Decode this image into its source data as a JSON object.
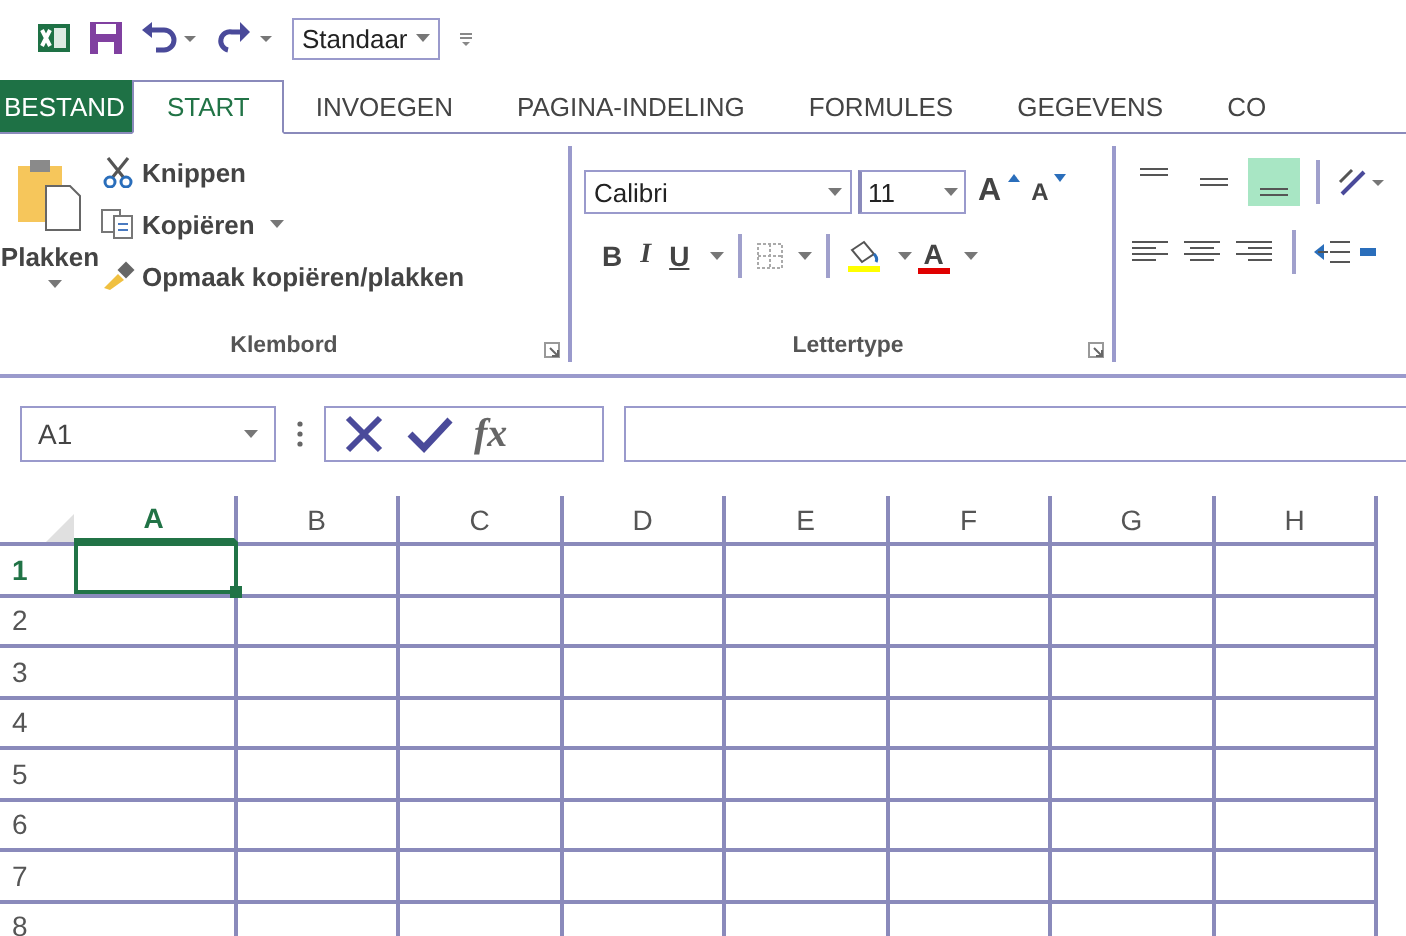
{
  "quick_access": {
    "style_box": "Standaar"
  },
  "tabs": [
    {
      "label": "BESTAND",
      "kind": "file",
      "selected": false
    },
    {
      "label": "START",
      "kind": "tab",
      "selected": true
    },
    {
      "label": "INVOEGEN",
      "kind": "tab",
      "selected": false
    },
    {
      "label": "PAGINA-INDELING",
      "kind": "tab",
      "selected": false
    },
    {
      "label": "FORMULES",
      "kind": "tab",
      "selected": false
    },
    {
      "label": "GEGEVENS",
      "kind": "tab",
      "selected": false
    },
    {
      "label": "CO",
      "kind": "tab",
      "selected": false
    }
  ],
  "clipboard": {
    "paste": "Plakken",
    "cut": "Knippen",
    "copy": "Kopiëren",
    "format_painter": "Opmaak kopiëren/plakken",
    "label": "Klembord"
  },
  "font": {
    "name": "Calibri",
    "size": "11",
    "grow": "A",
    "shrink": "A",
    "bold": "B",
    "italic": "I",
    "underline": "U",
    "font_color": "A",
    "label": "Lettertype"
  },
  "alignment": {
    "vertical": [
      {
        "selected": false
      },
      {
        "selected": false
      },
      {
        "selected": true
      }
    ]
  },
  "formula_bar": {
    "name_box": "A1",
    "fx": "fx"
  },
  "grid": {
    "columns": [
      {
        "label": "A",
        "selected": true
      },
      {
        "label": "B",
        "selected": false
      },
      {
        "label": "C",
        "selected": false
      },
      {
        "label": "D",
        "selected": false
      },
      {
        "label": "E",
        "selected": false
      },
      {
        "label": "F",
        "selected": false
      },
      {
        "label": "G",
        "selected": false
      },
      {
        "label": "H",
        "selected": false
      }
    ],
    "rows": [
      {
        "label": "1",
        "selected": true
      },
      {
        "label": "2",
        "selected": false
      },
      {
        "label": "3",
        "selected": false
      },
      {
        "label": "4",
        "selected": false
      },
      {
        "label": "5",
        "selected": false
      },
      {
        "label": "6",
        "selected": false
      },
      {
        "label": "7",
        "selected": false
      },
      {
        "label": "8",
        "selected": false
      }
    ]
  }
}
